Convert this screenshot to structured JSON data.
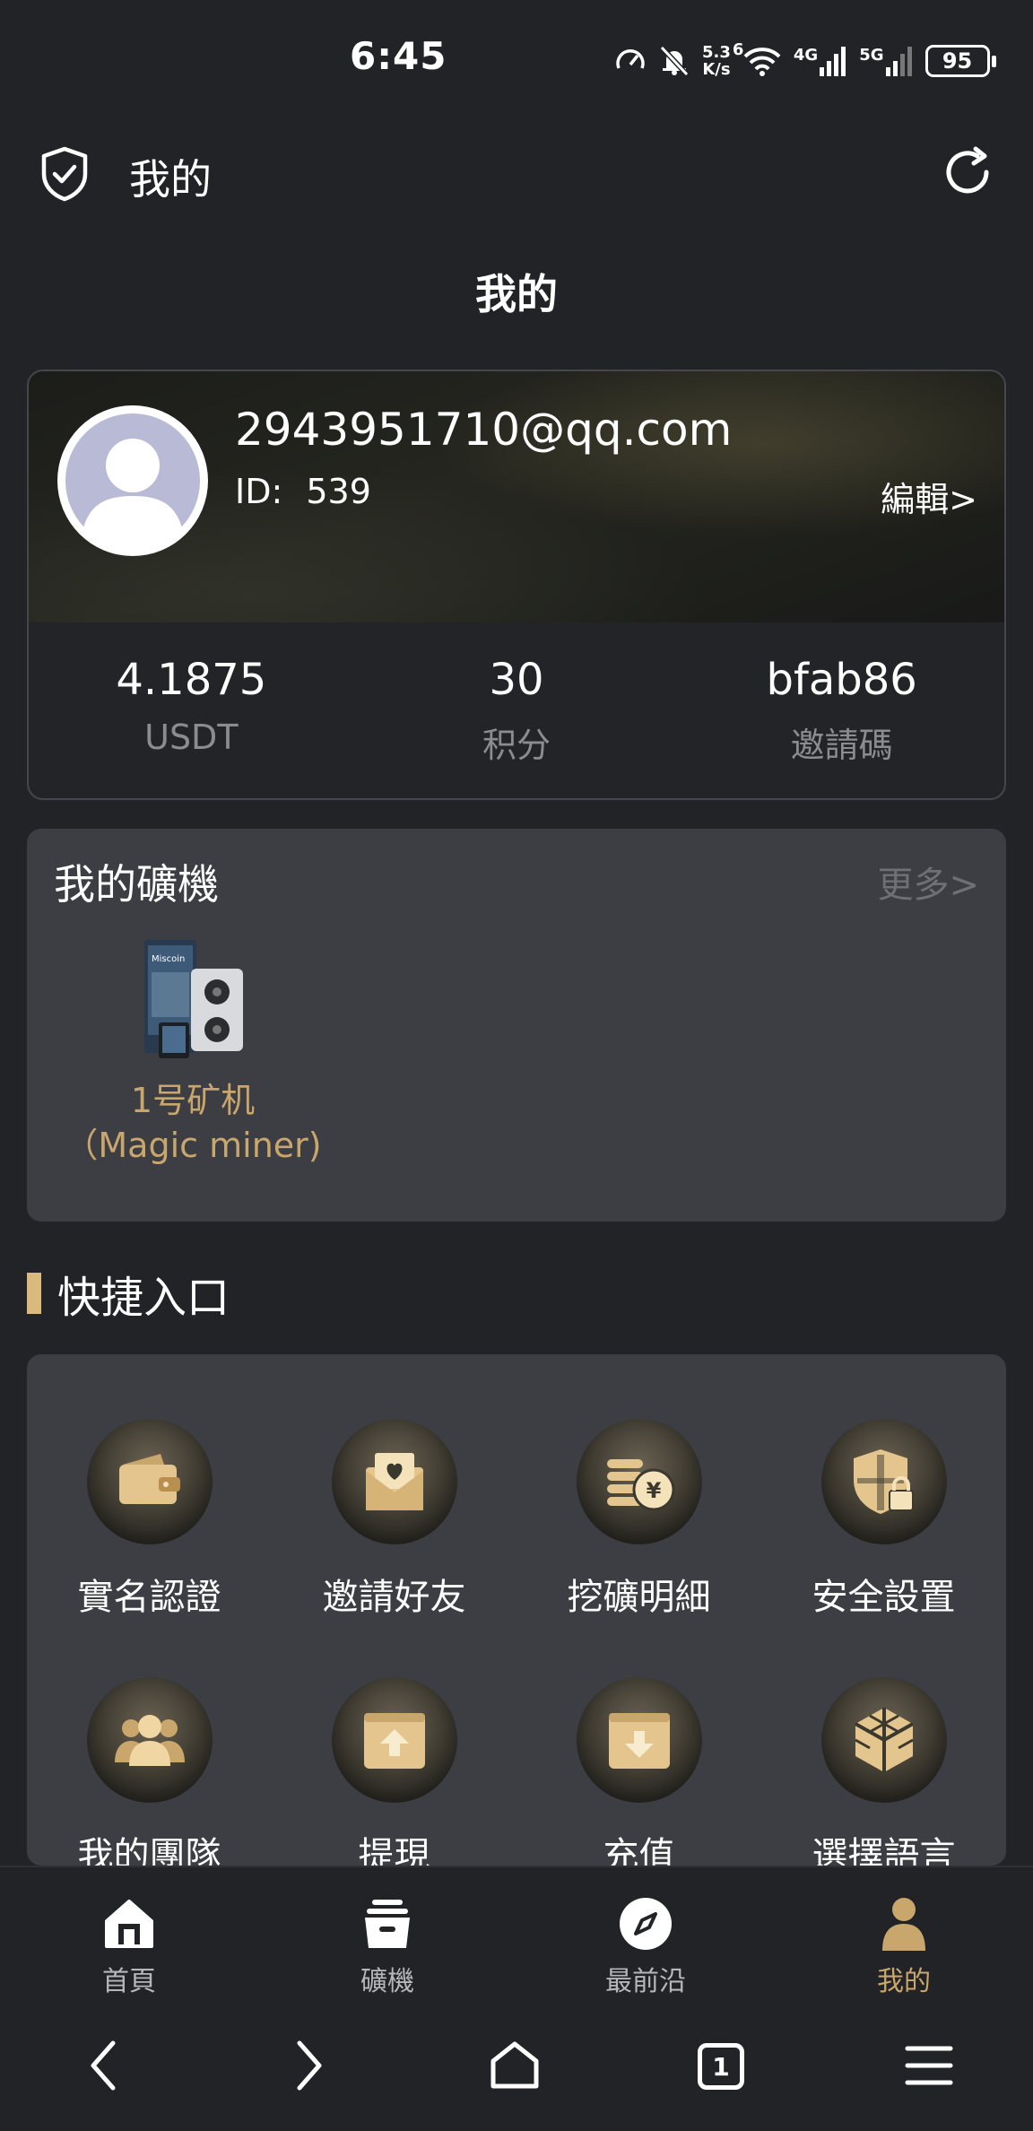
{
  "status_bar": {
    "time": "6:45",
    "net_speed_value": "5.3",
    "net_speed_unit": "K/s",
    "wifi_badge": "6",
    "signal_1": "4G",
    "signal_2": "5G",
    "battery": "95"
  },
  "header": {
    "title": "我的"
  },
  "page_title": "我的",
  "profile": {
    "email": "2943951710@qq.com",
    "id_label": "ID:",
    "id_value": "539",
    "edit_label": "編輯>",
    "stats": [
      {
        "value": "4.1875",
        "label": "USDT"
      },
      {
        "value": "30",
        "label": "积分"
      },
      {
        "value": "bfab86",
        "label": "邀請碼"
      }
    ]
  },
  "miners": {
    "title": "我的礦機",
    "more_label": "更多>",
    "items": [
      {
        "name": "1号矿机 （Magic miner)",
        "image_text": "Miscoin"
      }
    ]
  },
  "quick_entry": {
    "title": "快捷入口",
    "items": [
      {
        "label": "實名認證",
        "icon": "wallet-icon"
      },
      {
        "label": "邀請好友",
        "icon": "invite-heart-icon"
      },
      {
        "label": "挖礦明細",
        "icon": "coins-yuan-icon"
      },
      {
        "label": "安全設置",
        "icon": "shield-lock-icon"
      },
      {
        "label": "我的團隊",
        "icon": "team-icon"
      },
      {
        "label": "提現",
        "icon": "withdraw-box-icon"
      },
      {
        "label": "充值",
        "icon": "deposit-box-icon"
      },
      {
        "label": "選擇語言",
        "icon": "cubes-icon"
      }
    ]
  },
  "bottom_nav": [
    {
      "label": "首頁",
      "icon": "home-icon"
    },
    {
      "label": "礦機",
      "icon": "miner-stack-icon"
    },
    {
      "label": "最前沿",
      "icon": "compass-icon"
    },
    {
      "label": "我的",
      "icon": "user-icon",
      "active": true
    }
  ],
  "system_bar": {
    "tab_count": "1"
  },
  "colors": {
    "background": "#212326",
    "card": "#3c3e44",
    "gold": "#c9a66b",
    "accent_bar": "#d9b97c"
  }
}
